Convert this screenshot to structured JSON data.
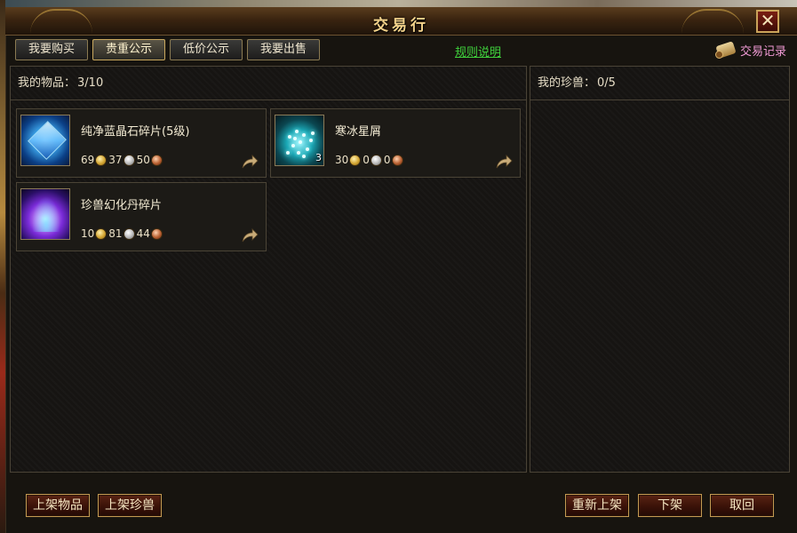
{
  "window": {
    "title": "交易行",
    "close_symbol": "✕"
  },
  "tabs": [
    {
      "label": "我要购买",
      "active": false
    },
    {
      "label": "贵重公示",
      "active": true
    },
    {
      "label": "低价公示",
      "active": false
    },
    {
      "label": "我要出售",
      "active": false
    }
  ],
  "rules_link": "规则说明",
  "record": {
    "label": "交易记录",
    "icon": "scroll-icon"
  },
  "left_panel": {
    "label": "我的物品：",
    "count": "3/10"
  },
  "right_panel": {
    "label": "我的珍兽：",
    "count": "0/5"
  },
  "items": [
    {
      "name": "纯净蓝晶石碎片(5级)",
      "gold": "69",
      "silver": "37",
      "copper": "50",
      "quantity": ""
    },
    {
      "name": "寒冰星屑",
      "gold": "30",
      "silver": "0",
      "copper": "0",
      "quantity": "3"
    },
    {
      "name": "珍兽幻化丹碎片",
      "gold": "10",
      "silver": "81",
      "copper": "44",
      "quantity": ""
    }
  ],
  "buttons": {
    "list_item": "上架物品",
    "list_pet": "上架珍兽",
    "relist": "重新上架",
    "unlist": "下架",
    "cancel": "取回"
  },
  "colors": {
    "title": "#f3d28a",
    "rules_link": "#3fd23c",
    "record_label": "#f09ad4",
    "button_bg": "#3a1208",
    "button_border": "#c49a52"
  }
}
